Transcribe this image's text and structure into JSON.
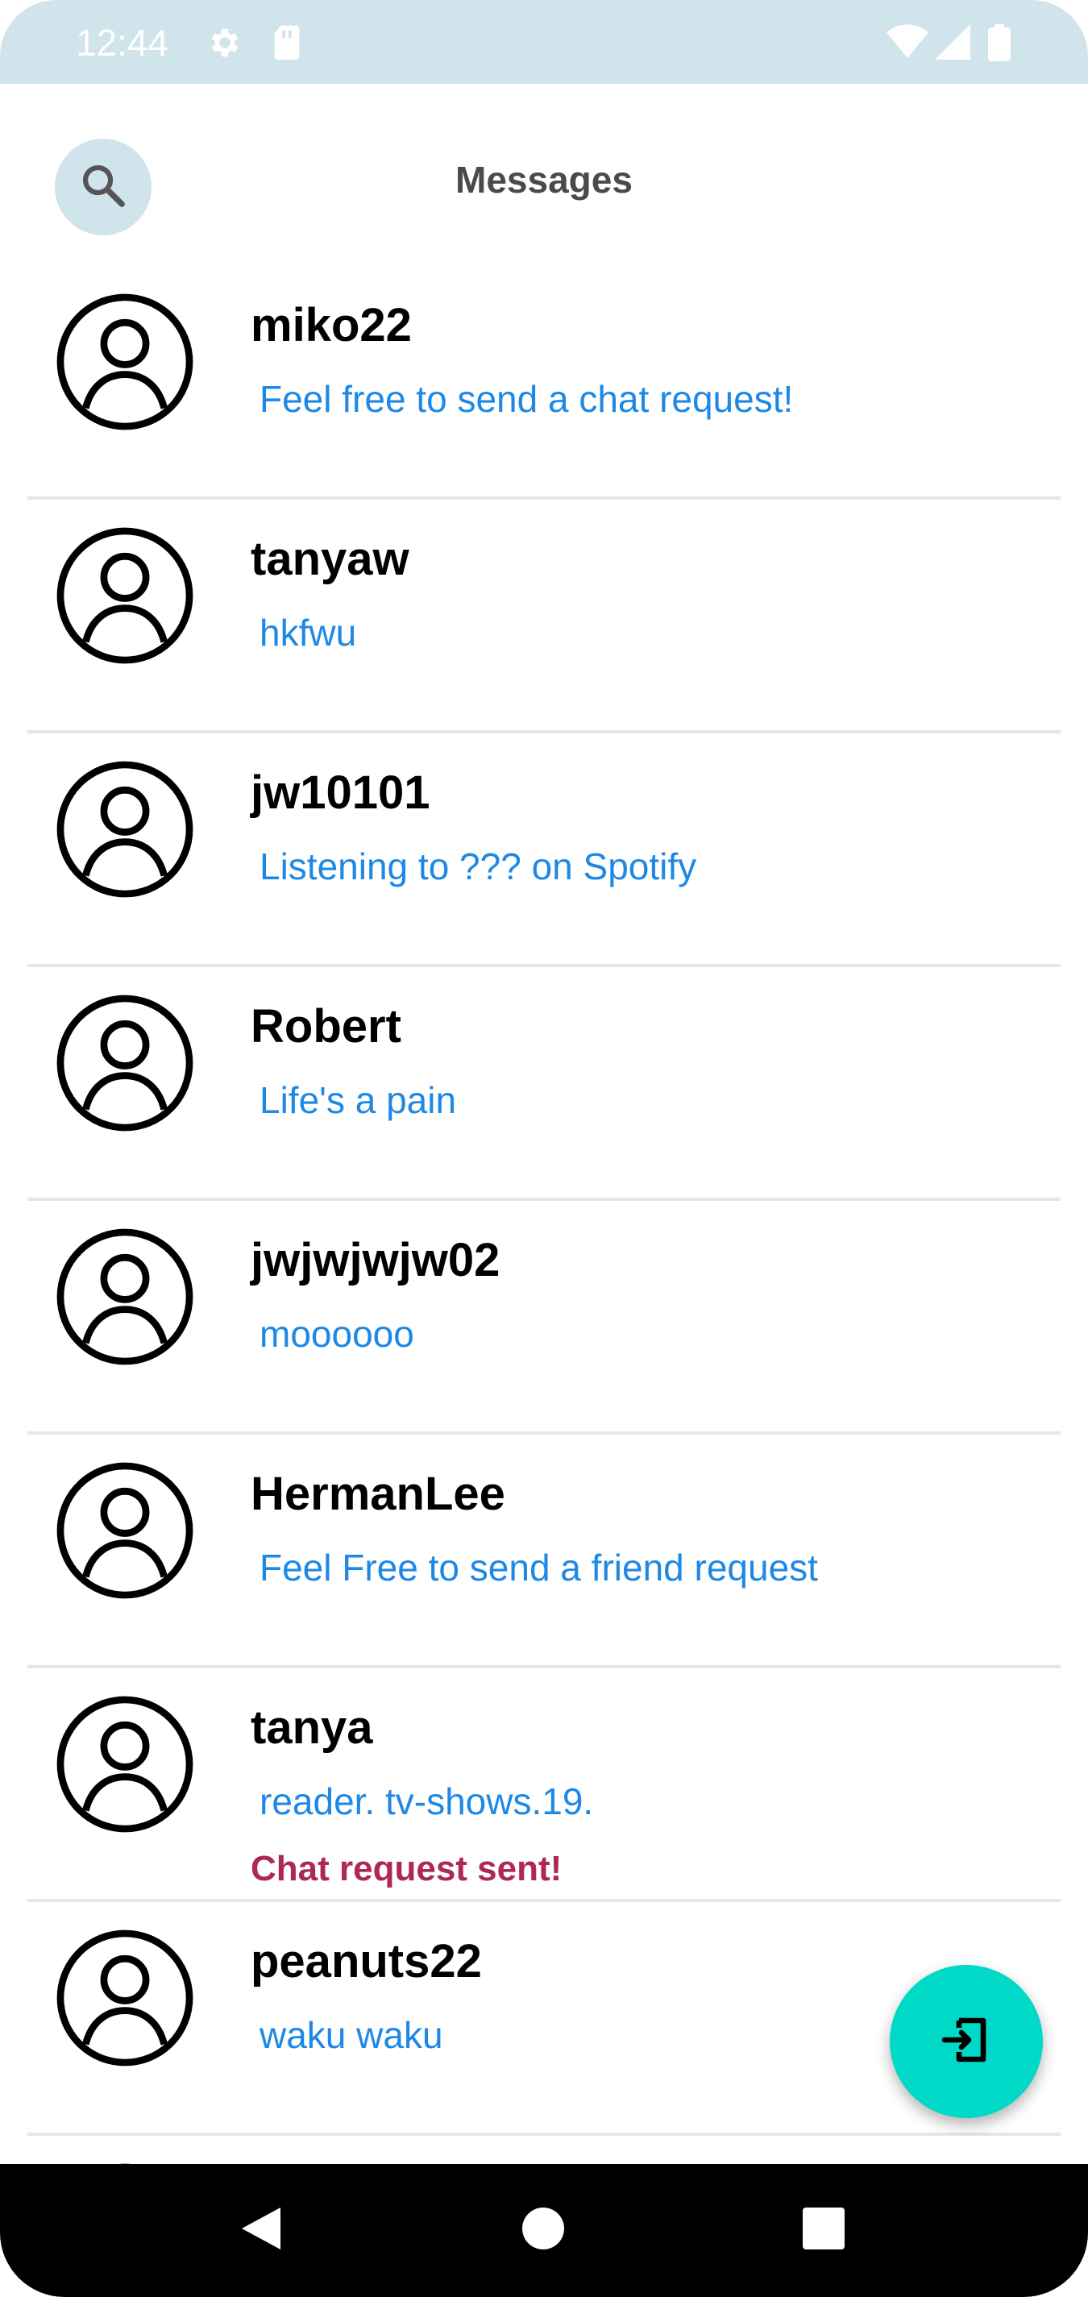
{
  "status_bar": {
    "time": "12:44",
    "icons": [
      "gear-icon",
      "sd-card-icon",
      "wifi-icon",
      "signal-icon",
      "battery-icon"
    ]
  },
  "header": {
    "title": "Messages",
    "search_icon": "search-icon"
  },
  "users": [
    {
      "name": "miko22",
      "status": "Feel free to send a chat request!",
      "note": ""
    },
    {
      "name": "tanyaw",
      "status": "hkfwu",
      "note": ""
    },
    {
      "name": "jw10101",
      "status": "Listening to ??? on Spotify",
      "note": ""
    },
    {
      "name": "Robert",
      "status": "Life's a pain",
      "note": ""
    },
    {
      "name": "jwjwjwjw02",
      "status": "moooooo",
      "note": ""
    },
    {
      "name": "HermanLee",
      "status": "Feel Free to send a friend request",
      "note": ""
    },
    {
      "name": "tanya",
      "status": "reader. tv-shows.19.",
      "note": "Chat request sent!"
    },
    {
      "name": "peanuts22",
      "status": "waku waku",
      "note": ""
    }
  ],
  "fab": {
    "icon": "exit-to-app-icon"
  },
  "nav_bar": {
    "icons": [
      "back-icon",
      "home-icon",
      "recents-icon"
    ]
  },
  "colors": {
    "accent": "#00d9c8",
    "status_text": "#1e88e5",
    "note_text": "#ad2955",
    "header_bg": "#d0e4ec"
  }
}
